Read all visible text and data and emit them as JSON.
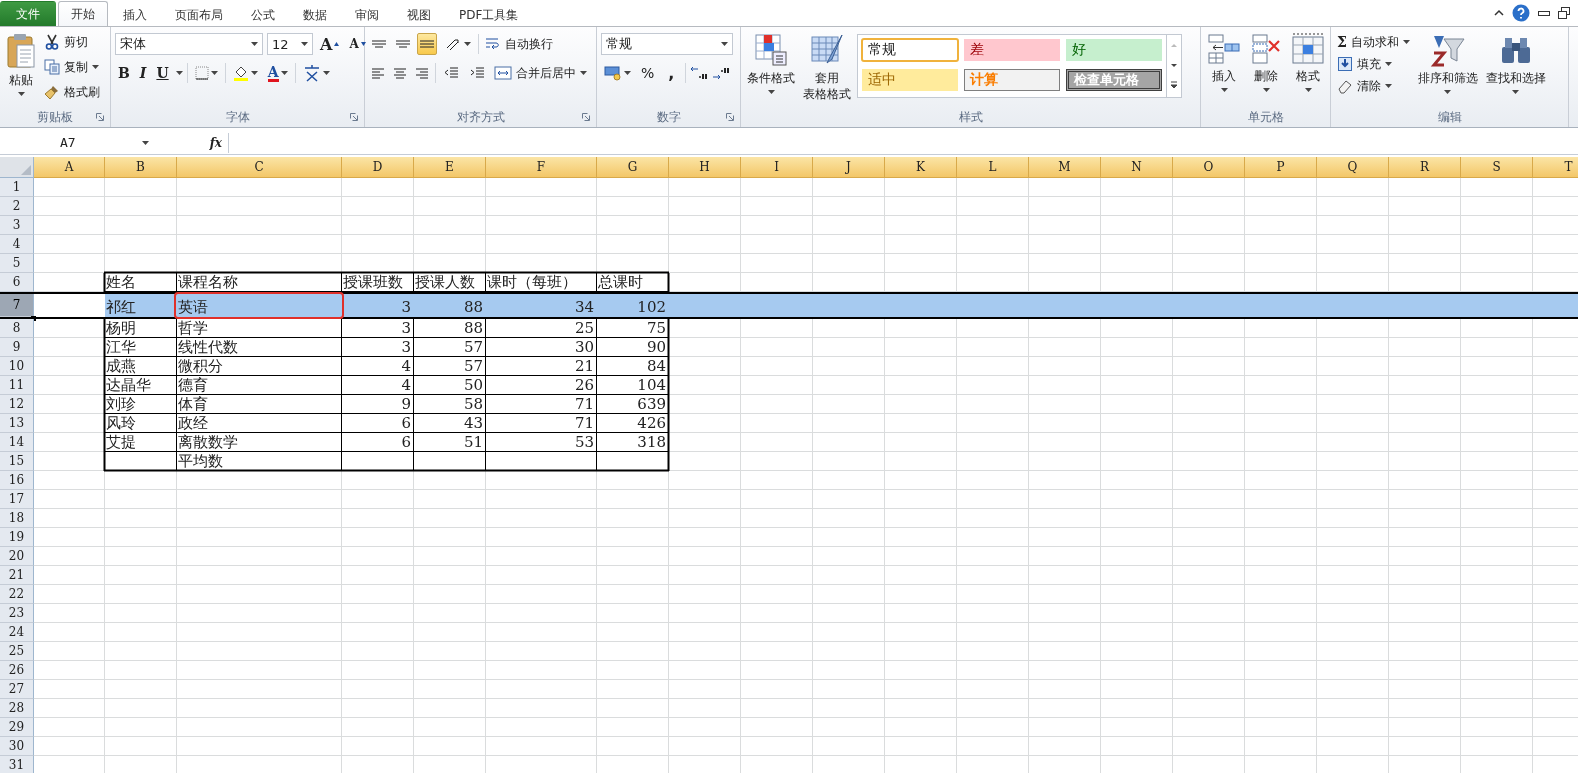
{
  "tabs": [
    {
      "label": "文件",
      "kind": "file",
      "selected": false
    },
    {
      "label": "开始",
      "kind": "tab",
      "selected": true
    },
    {
      "label": "插入",
      "kind": "tab",
      "selected": false
    },
    {
      "label": "页面布局",
      "kind": "tab",
      "selected": false
    },
    {
      "label": "公式",
      "kind": "tab",
      "selected": false
    },
    {
      "label": "数据",
      "kind": "tab",
      "selected": false
    },
    {
      "label": "审阅",
      "kind": "tab",
      "selected": false
    },
    {
      "label": "视图",
      "kind": "tab",
      "selected": false
    },
    {
      "label": "PDF工具集",
      "kind": "tab",
      "selected": false
    }
  ],
  "ribbon": {
    "groups": [
      {
        "kind": "clipboard",
        "label": "剪贴板",
        "paste": "粘贴",
        "items": [
          {
            "label": "剪切",
            "dropdown": false
          },
          {
            "label": "复制",
            "dropdown": true
          },
          {
            "label": "格式刷",
            "dropdown": false
          }
        ]
      },
      {
        "kind": "font",
        "label": "字体",
        "font_name": "宋体",
        "font_size": "12",
        "grow": "A",
        "shrink": "A",
        "bold": "B",
        "italic": "I",
        "underline": "U",
        "font_color": "A"
      },
      {
        "kind": "alignment",
        "label": "对齐方式",
        "vertical": [
          {
            "selected": false
          },
          {
            "selected": false
          },
          {
            "selected": true
          }
        ],
        "horizontal": [
          {
            "selected": false
          },
          {
            "selected": false
          },
          {
            "selected": false
          }
        ],
        "wrap": "自动换行",
        "merge": "合并后居中"
      },
      {
        "kind": "number",
        "label": "数字",
        "format": "常规",
        "percent": "%",
        "comma": ","
      },
      {
        "kind": "styles",
        "label": "样式",
        "conditional": "条件格式",
        "table_format": [
          "套用",
          "表格格式"
        ],
        "gallery": [
          {
            "label": "常规",
            "kind": "normal",
            "selected": true
          },
          {
            "label": "差",
            "kind": "bad",
            "selected": false
          },
          {
            "label": "好",
            "kind": "good",
            "selected": false
          },
          {
            "label": "适中",
            "kind": "neutral",
            "selected": false
          },
          {
            "label": "计算",
            "kind": "calc",
            "selected": false
          },
          {
            "label": "检查单元格",
            "kind": "check",
            "selected": false
          }
        ]
      },
      {
        "kind": "cells",
        "label": "单元格",
        "items": [
          {
            "label": "插入"
          },
          {
            "label": "删除"
          },
          {
            "label": "格式"
          }
        ]
      },
      {
        "kind": "editing",
        "label": "编辑",
        "small": [
          {
            "label": "自动求和",
            "glyph": "Σ"
          },
          {
            "label": "填充"
          },
          {
            "label": "清除"
          }
        ],
        "big": [
          {
            "label": "排序和筛选"
          },
          {
            "label": "查找和选择"
          }
        ]
      }
    ]
  },
  "formula_bar": {
    "name_box": "A7",
    "fx": "fx"
  },
  "sheet": {
    "columns": [
      {
        "label": "A",
        "selected": true
      },
      {
        "label": "B",
        "selected": true
      },
      {
        "label": "C",
        "selected": true
      },
      {
        "label": "D",
        "selected": true
      },
      {
        "label": "E",
        "selected": true
      },
      {
        "label": "F",
        "selected": true
      },
      {
        "label": "G",
        "selected": true
      },
      {
        "label": "H",
        "selected": true
      },
      {
        "label": "I",
        "selected": true
      },
      {
        "label": "J",
        "selected": true
      },
      {
        "label": "K",
        "selected": true
      },
      {
        "label": "L",
        "selected": true
      },
      {
        "label": "M",
        "selected": true
      },
      {
        "label": "N",
        "selected": true
      },
      {
        "label": "O",
        "selected": true
      },
      {
        "label": "P",
        "selected": true
      },
      {
        "label": "Q",
        "selected": true
      },
      {
        "label": "R",
        "selected": true
      },
      {
        "label": "S",
        "selected": true
      },
      {
        "label": "T",
        "selected": true
      }
    ],
    "rows": [
      {
        "label": "1",
        "selected": false
      },
      {
        "label": "2",
        "selected": false
      },
      {
        "label": "3",
        "selected": false
      },
      {
        "label": "4",
        "selected": false
      },
      {
        "label": "5",
        "selected": false
      },
      {
        "label": "6",
        "selected": false
      },
      {
        "label": "7",
        "selected": true
      },
      {
        "label": "8",
        "selected": false
      },
      {
        "label": "9",
        "selected": false
      },
      {
        "label": "10",
        "selected": false
      },
      {
        "label": "11",
        "selected": false
      },
      {
        "label": "12",
        "selected": false
      },
      {
        "label": "13",
        "selected": false
      },
      {
        "label": "14",
        "selected": false
      },
      {
        "label": "15",
        "selected": false
      },
      {
        "label": "16",
        "selected": false
      },
      {
        "label": "17",
        "selected": false
      },
      {
        "label": "18",
        "selected": false
      },
      {
        "label": "19",
        "selected": false
      },
      {
        "label": "20",
        "selected": false
      },
      {
        "label": "21",
        "selected": false
      },
      {
        "label": "22",
        "selected": false
      },
      {
        "label": "23",
        "selected": false
      },
      {
        "label": "24",
        "selected": false
      },
      {
        "label": "25",
        "selected": false
      },
      {
        "label": "26",
        "selected": false
      },
      {
        "label": "27",
        "selected": false
      },
      {
        "label": "28",
        "selected": false
      },
      {
        "label": "29",
        "selected": false
      },
      {
        "label": "30",
        "selected": false
      },
      {
        "label": "31",
        "selected": false
      }
    ],
    "table": {
      "columns": [
        {
          "label": "姓名",
          "kind": "text"
        },
        {
          "label": "课程名称",
          "kind": "text"
        },
        {
          "label": "授课班数",
          "kind": "number"
        },
        {
          "label": "授课人数",
          "kind": "number"
        },
        {
          "label": "课时（每班）",
          "kind": "number"
        },
        {
          "label": "总课时",
          "kind": "number"
        }
      ],
      "rows": [
        {
          "annotated": true,
          "cells": [
            "祁红",
            "英语",
            "3",
            "88",
            "34",
            "102"
          ]
        },
        {
          "annotated": false,
          "cells": [
            "杨明",
            "哲学",
            "3",
            "88",
            "25",
            "75"
          ]
        },
        {
          "annotated": false,
          "cells": [
            "江华",
            "线性代数",
            "3",
            "57",
            "30",
            "90"
          ]
        },
        {
          "annotated": false,
          "cells": [
            "成燕",
            "微积分",
            "4",
            "57",
            "21",
            "84"
          ]
        },
        {
          "annotated": false,
          "cells": [
            "达晶华",
            "德育",
            "4",
            "50",
            "26",
            "104"
          ]
        },
        {
          "annotated": false,
          "cells": [
            "刘珍",
            "体育",
            "9",
            "58",
            "71",
            "639"
          ]
        },
        {
          "annotated": false,
          "cells": [
            "风玲",
            "政经",
            "6",
            "43",
            "71",
            "426"
          ]
        },
        {
          "annotated": false,
          "cells": [
            "艾提",
            "离散数学",
            "6",
            "51",
            "53",
            "318"
          ]
        },
        {
          "annotated": false,
          "cells": [
            null,
            "平均数",
            null,
            null,
            null,
            null
          ]
        }
      ]
    }
  }
}
